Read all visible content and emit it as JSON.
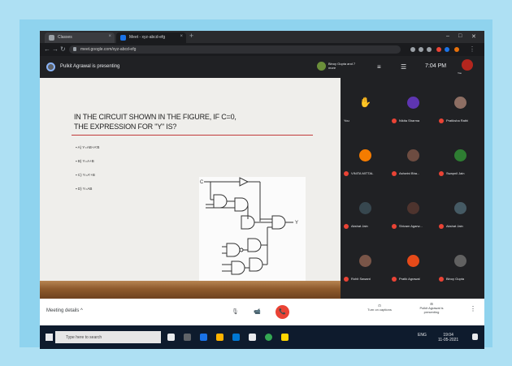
{
  "browser": {
    "tabs": [
      {
        "label": "Classes",
        "active": false
      },
      {
        "label": "Meet - xyz-abcd-efg",
        "active": true
      }
    ],
    "new_tab": "+",
    "url": "meet.google.com/xyz-abcd-efg",
    "window_controls": [
      "–",
      "□",
      "✕"
    ]
  },
  "meet_header": {
    "presenting_text": "Pulkit Agrawal is presenting",
    "pinned_name": "Binoy Gupta and 7 more",
    "clock": "7:04 PM",
    "you_label": "You"
  },
  "slide": {
    "title_line1": "IN THE CIRCUIT SHOWN IN THE FIGURE, IF C=0,",
    "title_line2": "THE EXPRESSION  FOR \"Y\" IS?",
    "options": [
      "A) Y=AB+A'B",
      "B) Y=A+B",
      "C) Y=A'+B",
      "D) Y=AB"
    ],
    "circuit_labels": {
      "c_input": "C",
      "output": "Y"
    }
  },
  "participants": [
    {
      "name": "You",
      "color": "#202124",
      "muted": false
    },
    {
      "name": "Nikita Sharma",
      "color": "#5e35b1",
      "muted": true
    },
    {
      "name": "Pratiksha Rathi",
      "color": "#8d6e63",
      "muted": true
    },
    {
      "name": "VINITA MITTAL",
      "color": "#f57c00",
      "muted": true
    },
    {
      "name": "Ashwini Bha...",
      "color": "#6d4c41",
      "muted": true
    },
    {
      "name": "Swapnil Jain",
      "color": "#2e7d32",
      "muted": true
    },
    {
      "name": "Akshat Jain",
      "color": "#37474f",
      "muted": true
    },
    {
      "name": "Shivam Agarw...",
      "color": "#4e342e",
      "muted": true
    },
    {
      "name": "Akshat Jain",
      "color": "#455a64",
      "muted": true
    },
    {
      "name": "Rohit Sawant",
      "color": "#795548",
      "muted": true
    },
    {
      "name": "Pratik Agrawal",
      "color": "#e64a19",
      "muted": true
    },
    {
      "name": "Binoy Gupta",
      "color": "#616161",
      "muted": false
    }
  ],
  "controls": {
    "meeting_details": "Meeting details",
    "chevron": "^",
    "mic_icon": "🎙",
    "camera_icon": "📹",
    "end_call_icon": "📞",
    "turn_on_captions": "Turn on captions",
    "presenting_label": "Pulkit Agrawal is presenting",
    "more": "⋮"
  },
  "taskbar": {
    "search_placeholder": "Type here to search",
    "time": "19:04",
    "date": "11-05-2021",
    "lang": "ENG"
  },
  "colors": {
    "meet_bg": "#202124",
    "accent_red": "#ea4335",
    "slide_bg": "#efeeeb",
    "title_underline": "#c23b3b",
    "frame": "#aee0f3"
  }
}
